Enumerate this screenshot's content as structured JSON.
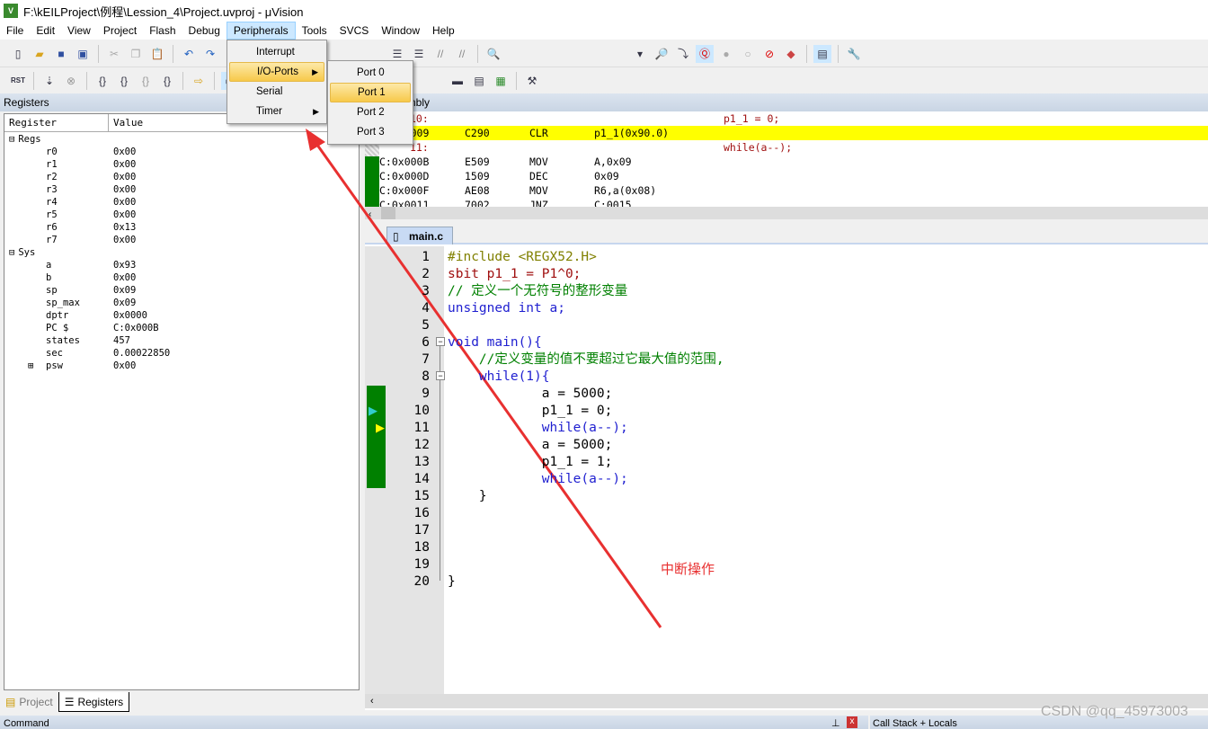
{
  "window": {
    "title": "F:\\kEILProject\\例程\\Lession_4\\Project.uvproj - μVision"
  },
  "menubar": [
    "File",
    "Edit",
    "View",
    "Project",
    "Flash",
    "Debug",
    "Peripherals",
    "Tools",
    "SVCS",
    "Window",
    "Help"
  ],
  "peripherals_menu": {
    "items": [
      {
        "label": "Interrupt"
      },
      {
        "label": "I/O-Ports",
        "submenu": true
      },
      {
        "label": "Serial"
      },
      {
        "label": "Timer",
        "submenu": true
      }
    ],
    "highlighted": "I/O-Ports"
  },
  "io_ports_submenu": {
    "items": [
      "Port 0",
      "Port 1",
      "Port 2",
      "Port 3"
    ],
    "highlighted": "Port 1"
  },
  "registers": {
    "title": "Registers",
    "col_register": "Register",
    "col_value": "Value",
    "groups": [
      {
        "name": "Regs",
        "items": [
          [
            "r0",
            "0x00"
          ],
          [
            "r1",
            "0x00"
          ],
          [
            "r2",
            "0x00"
          ],
          [
            "r3",
            "0x00"
          ],
          [
            "r4",
            "0x00"
          ],
          [
            "r5",
            "0x00"
          ],
          [
            "r6",
            "0x13"
          ],
          [
            "r7",
            "0x00"
          ]
        ]
      },
      {
        "name": "Sys",
        "items": [
          [
            "a",
            "0x93"
          ],
          [
            "b",
            "0x00"
          ],
          [
            "sp",
            "0x09"
          ],
          [
            "sp_max",
            "0x09"
          ],
          [
            "dptr",
            "0x0000"
          ],
          [
            "PC  $",
            "C:0x000B"
          ],
          [
            "states",
            "457"
          ],
          [
            "sec",
            "0.00022850"
          ],
          [
            "psw",
            "0x00"
          ]
        ]
      }
    ]
  },
  "bottom_tabs": [
    "Project",
    "Registers"
  ],
  "disassembly": {
    "title": "Disassembly",
    "lines": [
      {
        "addr": "10:",
        "src": "p1_1 = 0;"
      },
      {
        "addr": "C:0x0009",
        "code": "C290",
        "op": "CLR",
        "arg": "p1_1(0x90.0)",
        "current": true
      },
      {
        "addr": "11:",
        "src": "while(a--);"
      },
      {
        "addr": "C:0x000B",
        "code": "E509",
        "op": "MOV",
        "arg": "A,0x09",
        "pc": true
      },
      {
        "addr": "C:0x000D",
        "code": "1509",
        "op": "DEC",
        "arg": "0x09"
      },
      {
        "addr": "C:0x000F",
        "code": "AE08",
        "op": "MOV",
        "arg": "R6,a(0x08)"
      },
      {
        "addr": "C:0x0011",
        "code": "7002",
        "op": "JNZ",
        "arg": "C:0015"
      }
    ]
  },
  "editor": {
    "tab": "main.c",
    "lines": [
      "#include <REGX52.H>",
      "sbit p1_1 = P1^0;",
      "// 定义一个无符号的整形变量",
      "unsigned int a;",
      "",
      "void main(){",
      "    //定义变量的值不要超过它最大值的范围,",
      "    while(1){",
      "            a = 5000;",
      "            p1_1 = 0;",
      "            while(a--);",
      "            a = 5000;",
      "            p1_1 = 1;",
      "            while(a--);",
      "    }",
      "",
      "",
      "",
      "",
      "}"
    ]
  },
  "annotation": "中断操作",
  "bottom": {
    "command": "Command",
    "callstack": "Call Stack + Locals"
  },
  "watermark": "CSDN @qq_45973003",
  "colors": {
    "highlight_line": "#ffff00",
    "coverage": "#008000",
    "arrow": "#e83030"
  }
}
